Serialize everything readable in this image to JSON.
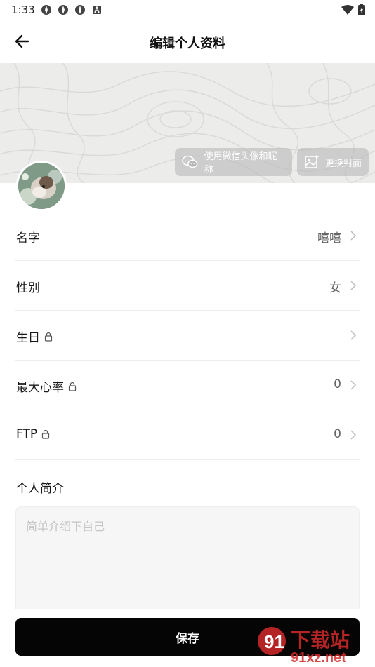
{
  "status_bar": {
    "time": "1:33"
  },
  "header": {
    "title": "编辑个人资料"
  },
  "cover": {
    "wechat_button_label": "使用微信头像和昵称",
    "change_cover_label": "更换封面"
  },
  "fields": [
    {
      "label": "名字",
      "value": "嘻嘻",
      "locked": false
    },
    {
      "label": "性别",
      "value": "女",
      "locked": false
    },
    {
      "label": "生日",
      "value": "",
      "locked": true
    },
    {
      "label": "最大心率",
      "value": "0",
      "locked": true
    },
    {
      "label": "FTP",
      "value": "0",
      "locked": true
    }
  ],
  "bio": {
    "title": "个人简介",
    "placeholder": "简单介绍下自己",
    "value": ""
  },
  "footer": {
    "save_label": "保存"
  },
  "watermark": {
    "brand": "下载站",
    "url": "91xz.net"
  }
}
